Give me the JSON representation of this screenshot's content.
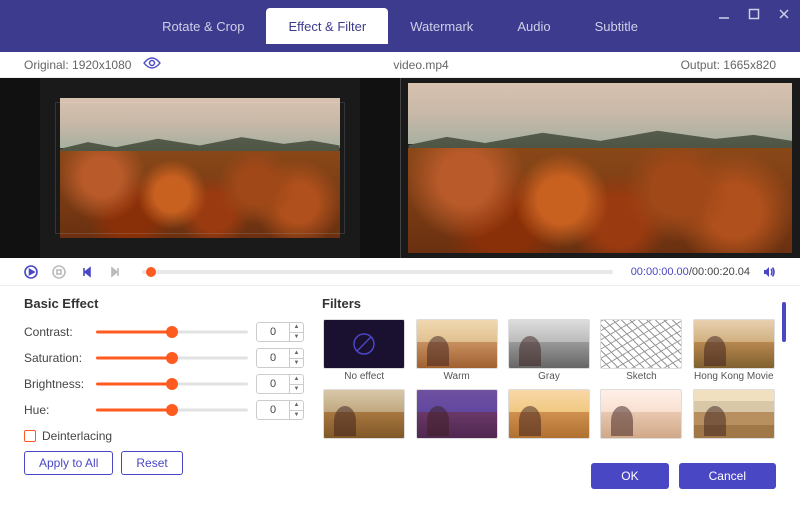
{
  "tabs": {
    "rotate": "Rotate & Crop",
    "effect": "Effect & Filter",
    "watermark": "Watermark",
    "audio": "Audio",
    "subtitle": "Subtitle"
  },
  "info": {
    "original_label": "Original:",
    "original_value": "1920x1080",
    "filename": "video.mp4",
    "output_label": "Output:",
    "output_value": "1665x820"
  },
  "playback": {
    "current_time": "00:00:00.00",
    "total_time": "00:00:20.04",
    "separator": "/"
  },
  "basic_effect": {
    "title": "Basic Effect",
    "rows": [
      {
        "label": "Contrast:",
        "value": "0"
      },
      {
        "label": "Saturation:",
        "value": "0"
      },
      {
        "label": "Brightness:",
        "value": "0"
      },
      {
        "label": "Hue:",
        "value": "0"
      }
    ],
    "deinterlacing": "Deinterlacing",
    "apply_to_all": "Apply to All",
    "reset": "Reset"
  },
  "filters": {
    "title": "Filters",
    "items": [
      {
        "label": "No effect"
      },
      {
        "label": "Warm"
      },
      {
        "label": "Gray"
      },
      {
        "label": "Sketch"
      },
      {
        "label": "Hong Kong Movie"
      },
      {
        "label": ""
      },
      {
        "label": ""
      },
      {
        "label": ""
      },
      {
        "label": ""
      },
      {
        "label": ""
      }
    ]
  },
  "footer": {
    "ok": "OK",
    "cancel": "Cancel"
  }
}
